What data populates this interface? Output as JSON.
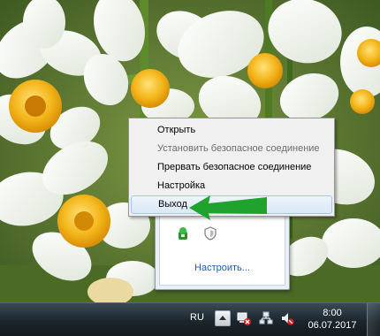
{
  "context_menu": {
    "items": [
      {
        "label": "Открыть",
        "enabled": true,
        "highlighted": false
      },
      {
        "label": "Установить безопасное соединение",
        "enabled": false,
        "highlighted": false
      },
      {
        "label": "Прервать безопасное соединение",
        "enabled": true,
        "highlighted": false
      },
      {
        "label": "Настройка",
        "enabled": true,
        "highlighted": false
      },
      {
        "label": "Выход",
        "enabled": true,
        "highlighted": true
      }
    ]
  },
  "tray_panel": {
    "icons": [
      "vpn-agent-icon",
      "shield-icon"
    ],
    "customize_link": "Настроить..."
  },
  "annotation": {
    "arrow_color": "#1fa22e"
  },
  "taskbar": {
    "language": "RU",
    "overflow_icon": "chevron-up-icon",
    "tray_icons": [
      "network-error-icon",
      "network-icon",
      "speaker-muted-icon"
    ],
    "clock": {
      "time": "8:00",
      "date": "06.07.2017"
    }
  },
  "colors": {
    "menu_highlight": "#dbe8f7",
    "link": "#1e5eb0",
    "taskbar": "#1b252c"
  }
}
